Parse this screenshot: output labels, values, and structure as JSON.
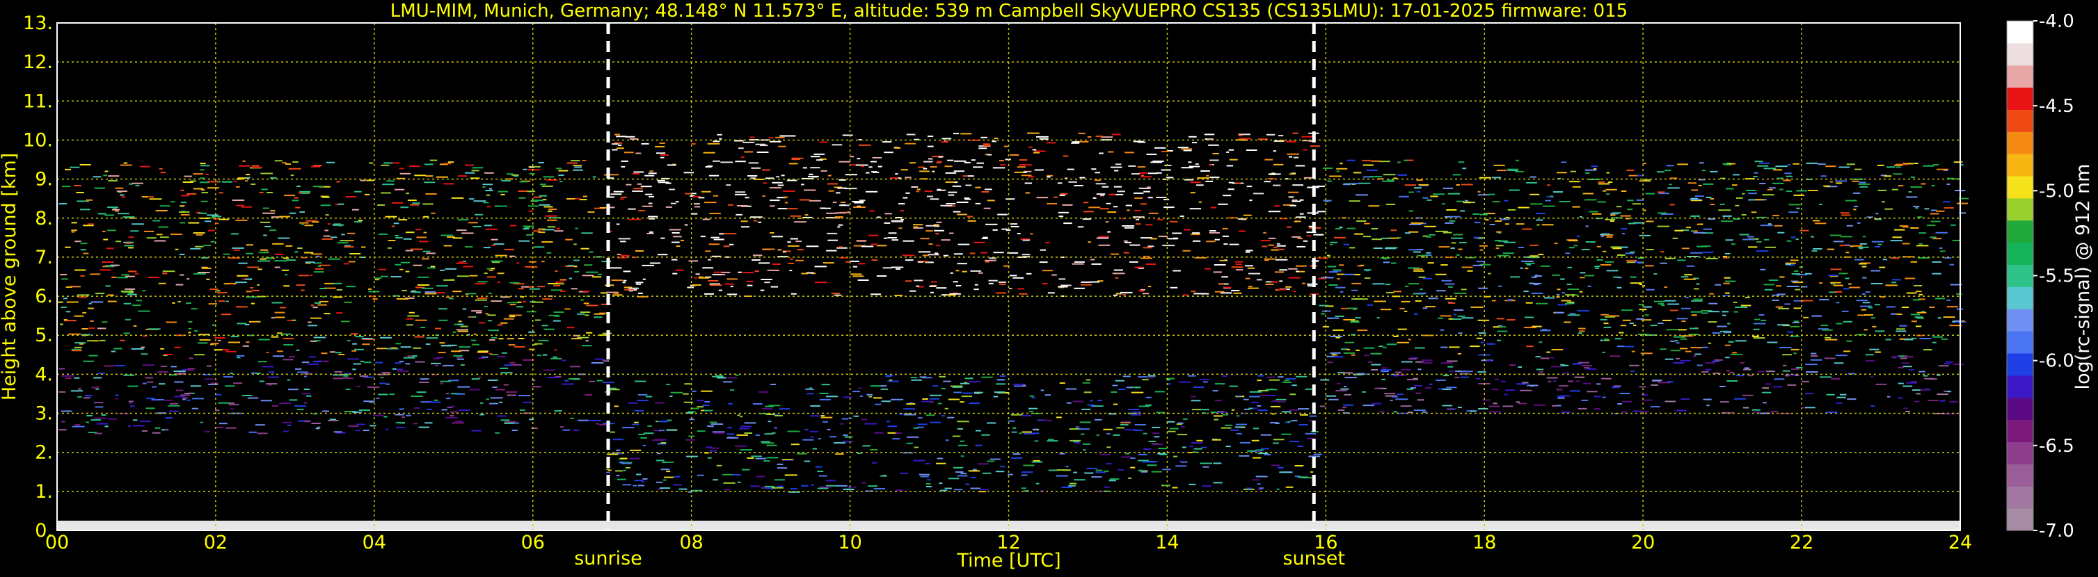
{
  "chart_data": {
    "type": "heatmap",
    "title": "LMU-MIM, Munich, Germany; 48.148° N 11.573° E, altitude: 539 m    Campbell SkyVUEPRO CS135 (CS135LMU): 17-01-2025    firmware: 015",
    "xlabel": "Time [UTC]",
    "ylabel": "Height above ground [km]",
    "xlim": [
      0,
      24
    ],
    "ylim": [
      0,
      13
    ],
    "x_ticks": [
      0,
      2,
      4,
      6,
      8,
      10,
      12,
      14,
      16,
      18,
      20,
      22,
      24
    ],
    "x_tick_labels": [
      "00",
      "02",
      "04",
      "06",
      "08",
      "10",
      "12",
      "14",
      "16",
      "18",
      "20",
      "22",
      "24"
    ],
    "y_ticks": [
      0,
      1,
      2,
      3,
      4,
      5,
      6,
      7,
      8,
      9,
      10,
      11,
      12,
      13
    ],
    "y_tick_labels": [
      "0.",
      "1.",
      "2.",
      "3.",
      "4.",
      "5.",
      "6.",
      "7.",
      "8.",
      "9.",
      "10.",
      "11.",
      "12.",
      "13."
    ],
    "grid": true,
    "markers": [
      {
        "label": "sunrise",
        "x": 6.95
      },
      {
        "label": "sunset",
        "x": 15.85
      }
    ],
    "colorbar": {
      "label": "log(rc-signal) @ 912 nm",
      "range": [
        -7.0,
        -4.0
      ],
      "ticks": [
        -4.0,
        -4.5,
        -5.0,
        -5.5,
        -6.0,
        -6.5,
        -7.0
      ],
      "tick_labels": [
        "-4.0",
        "-4.5",
        "-5.0",
        "-5.5",
        "-6.0",
        "-6.5",
        "-7.0"
      ],
      "colors": [
        "#a78aa3",
        "#a078a0",
        "#9a5d98",
        "#8c3d8c",
        "#7c1a7c",
        "#5b0a84",
        "#3a18c6",
        "#1f3fe6",
        "#4a74f0",
        "#6f8ff2",
        "#59c8d0",
        "#2ec28a",
        "#16b35a",
        "#20a83a",
        "#9ad02e",
        "#f5e21a",
        "#f8b612",
        "#f48a14",
        "#ef4a14",
        "#e81414",
        "#e8a8a8",
        "#eee0e0",
        "#ffffff"
      ]
    },
    "signal_regions": [
      {
        "x": [
          0,
          6.9
        ],
        "y": [
          4.5,
          9.5
        ],
        "log_signal": -5.0
      },
      {
        "x": [
          0,
          6.9
        ],
        "y": [
          2.5,
          4.5
        ],
        "log_signal": -6.0
      },
      {
        "x": [
          6.9,
          15.9
        ],
        "y": [
          6.0,
          10.2
        ],
        "log_signal": -4.2
      },
      {
        "x": [
          6.9,
          15.9
        ],
        "y": [
          1.0,
          4.0
        ],
        "log_signal": -5.6
      },
      {
        "x": [
          15.9,
          24
        ],
        "y": [
          4.5,
          9.5
        ],
        "log_signal": -5.3
      },
      {
        "x": [
          15.9,
          24
        ],
        "y": [
          3.0,
          4.5
        ],
        "log_signal": -6.2
      },
      {
        "x": [
          0,
          24
        ],
        "y": [
          0.0,
          0.25
        ],
        "log_signal": -4.0
      }
    ]
  }
}
